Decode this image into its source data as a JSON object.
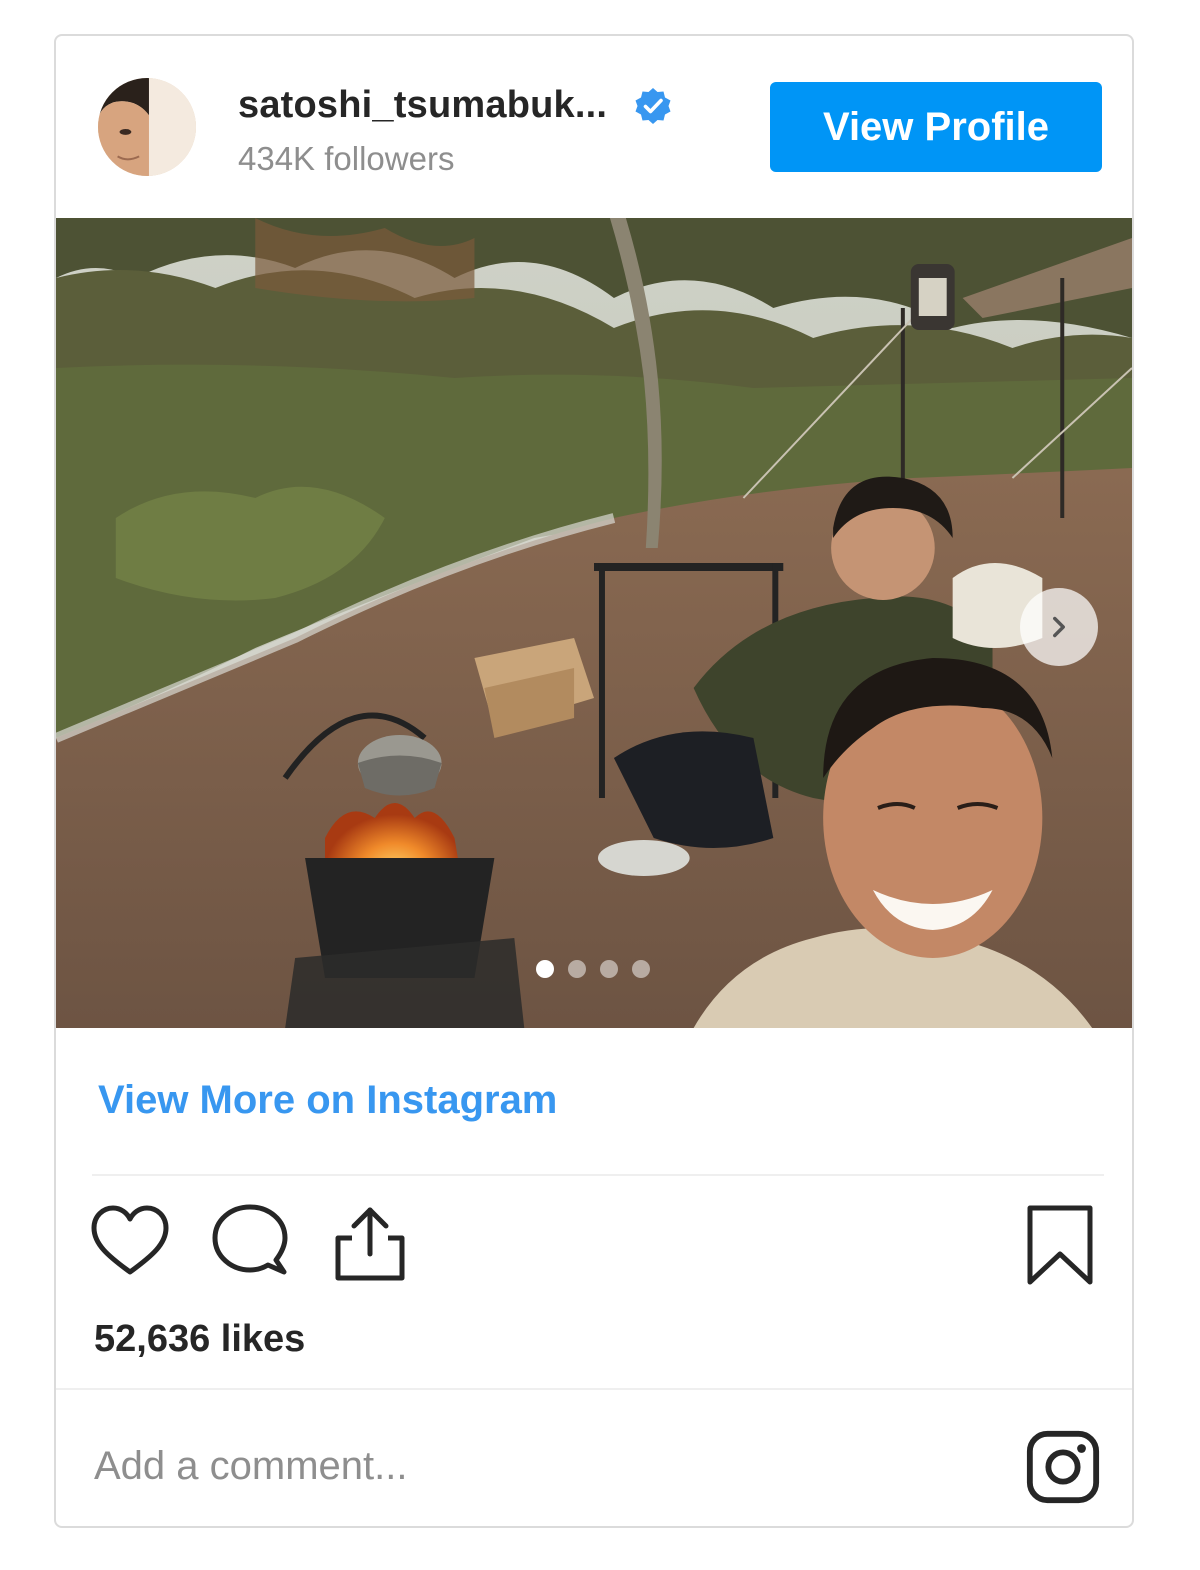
{
  "profile": {
    "username": "satoshi_tsumabuk...",
    "followers": "434K followers",
    "verified_icon": "verified-badge-icon",
    "view_profile_label": "View Profile"
  },
  "post": {
    "image_alt": "Two men at a campsite with a campfire and kettle",
    "carousel": {
      "total": 4,
      "current": 1
    }
  },
  "links": {
    "view_more": "View More on Instagram"
  },
  "actions": {
    "icons": [
      "heart-icon",
      "comment-icon",
      "share-icon",
      "bookmark-icon"
    ]
  },
  "stats": {
    "likes": "52,636 likes"
  },
  "comment": {
    "placeholder": "Add a comment...",
    "logo_icon": "instagram-logo-icon"
  },
  "colors": {
    "accent": "#0095f6",
    "link": "#3897f0",
    "text": "#262626",
    "muted": "#8e8e8e",
    "border": "#dbdbdb"
  }
}
